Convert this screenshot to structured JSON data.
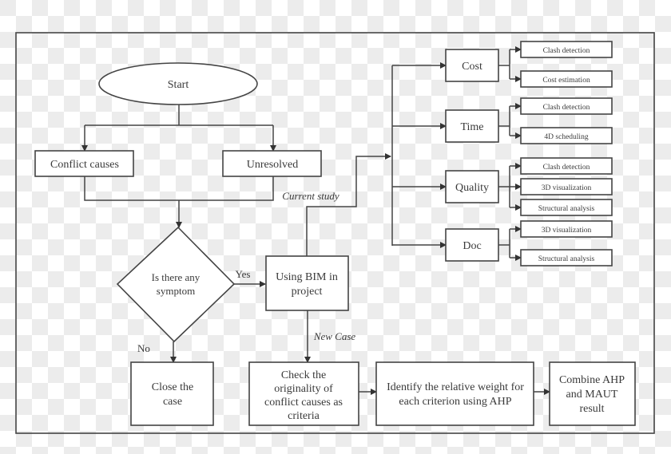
{
  "nodes": {
    "start": "Start",
    "conflict_causes": "Conflict causes",
    "unresolved": "Unresolved",
    "decision": [
      "Is there any",
      "symptom"
    ],
    "using_bim": [
      "Using BIM in",
      "project"
    ],
    "close_case": [
      "Close the",
      "case"
    ],
    "check_originality": [
      "Check the",
      "originality of",
      "conflict causes as",
      "criteria"
    ],
    "identify_weight": [
      "Identify the relative weight for",
      "each criterion using AHP"
    ],
    "combine": [
      "Combine AHP",
      "and MAUT",
      "result"
    ]
  },
  "edge_labels": {
    "current_study": "Current study",
    "yes": "Yes",
    "no": "No",
    "new_case": "New Case"
  },
  "criteria": [
    {
      "label": "Cost",
      "subs": [
        "Clash detection",
        "Cost estimation"
      ]
    },
    {
      "label": "Time",
      "subs": [
        "Clash detection",
        "4D scheduling"
      ]
    },
    {
      "label": "Quality",
      "subs": [
        "Clash detection",
        "3D visualization",
        "Structural analysis"
      ]
    },
    {
      "label": "Doc",
      "subs": [
        "3D visualization",
        "Structural analysis"
      ]
    }
  ]
}
